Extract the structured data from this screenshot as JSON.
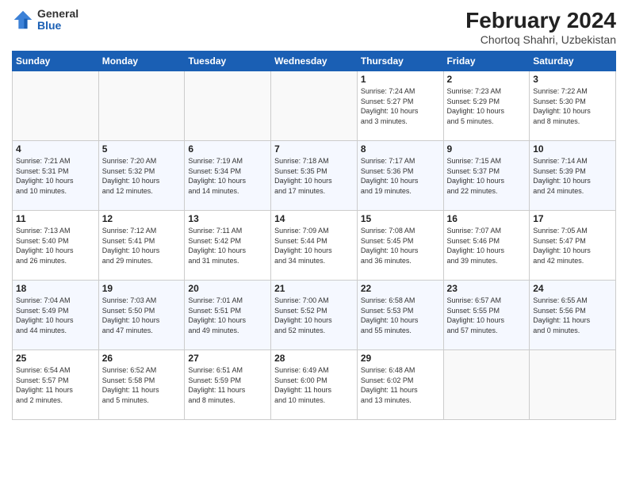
{
  "header": {
    "logo_general": "General",
    "logo_blue": "Blue",
    "month_year": "February 2024",
    "location": "Chortoq Shahri, Uzbekistan"
  },
  "days_of_week": [
    "Sunday",
    "Monday",
    "Tuesday",
    "Wednesday",
    "Thursday",
    "Friday",
    "Saturday"
  ],
  "weeks": [
    [
      {
        "day": "",
        "info": ""
      },
      {
        "day": "",
        "info": ""
      },
      {
        "day": "",
        "info": ""
      },
      {
        "day": "",
        "info": ""
      },
      {
        "day": "1",
        "info": "Sunrise: 7:24 AM\nSunset: 5:27 PM\nDaylight: 10 hours\nand 3 minutes."
      },
      {
        "day": "2",
        "info": "Sunrise: 7:23 AM\nSunset: 5:29 PM\nDaylight: 10 hours\nand 5 minutes."
      },
      {
        "day": "3",
        "info": "Sunrise: 7:22 AM\nSunset: 5:30 PM\nDaylight: 10 hours\nand 8 minutes."
      }
    ],
    [
      {
        "day": "4",
        "info": "Sunrise: 7:21 AM\nSunset: 5:31 PM\nDaylight: 10 hours\nand 10 minutes."
      },
      {
        "day": "5",
        "info": "Sunrise: 7:20 AM\nSunset: 5:32 PM\nDaylight: 10 hours\nand 12 minutes."
      },
      {
        "day": "6",
        "info": "Sunrise: 7:19 AM\nSunset: 5:34 PM\nDaylight: 10 hours\nand 14 minutes."
      },
      {
        "day": "7",
        "info": "Sunrise: 7:18 AM\nSunset: 5:35 PM\nDaylight: 10 hours\nand 17 minutes."
      },
      {
        "day": "8",
        "info": "Sunrise: 7:17 AM\nSunset: 5:36 PM\nDaylight: 10 hours\nand 19 minutes."
      },
      {
        "day": "9",
        "info": "Sunrise: 7:15 AM\nSunset: 5:37 PM\nDaylight: 10 hours\nand 22 minutes."
      },
      {
        "day": "10",
        "info": "Sunrise: 7:14 AM\nSunset: 5:39 PM\nDaylight: 10 hours\nand 24 minutes."
      }
    ],
    [
      {
        "day": "11",
        "info": "Sunrise: 7:13 AM\nSunset: 5:40 PM\nDaylight: 10 hours\nand 26 minutes."
      },
      {
        "day": "12",
        "info": "Sunrise: 7:12 AM\nSunset: 5:41 PM\nDaylight: 10 hours\nand 29 minutes."
      },
      {
        "day": "13",
        "info": "Sunrise: 7:11 AM\nSunset: 5:42 PM\nDaylight: 10 hours\nand 31 minutes."
      },
      {
        "day": "14",
        "info": "Sunrise: 7:09 AM\nSunset: 5:44 PM\nDaylight: 10 hours\nand 34 minutes."
      },
      {
        "day": "15",
        "info": "Sunrise: 7:08 AM\nSunset: 5:45 PM\nDaylight: 10 hours\nand 36 minutes."
      },
      {
        "day": "16",
        "info": "Sunrise: 7:07 AM\nSunset: 5:46 PM\nDaylight: 10 hours\nand 39 minutes."
      },
      {
        "day": "17",
        "info": "Sunrise: 7:05 AM\nSunset: 5:47 PM\nDaylight: 10 hours\nand 42 minutes."
      }
    ],
    [
      {
        "day": "18",
        "info": "Sunrise: 7:04 AM\nSunset: 5:49 PM\nDaylight: 10 hours\nand 44 minutes."
      },
      {
        "day": "19",
        "info": "Sunrise: 7:03 AM\nSunset: 5:50 PM\nDaylight: 10 hours\nand 47 minutes."
      },
      {
        "day": "20",
        "info": "Sunrise: 7:01 AM\nSunset: 5:51 PM\nDaylight: 10 hours\nand 49 minutes."
      },
      {
        "day": "21",
        "info": "Sunrise: 7:00 AM\nSunset: 5:52 PM\nDaylight: 10 hours\nand 52 minutes."
      },
      {
        "day": "22",
        "info": "Sunrise: 6:58 AM\nSunset: 5:53 PM\nDaylight: 10 hours\nand 55 minutes."
      },
      {
        "day": "23",
        "info": "Sunrise: 6:57 AM\nSunset: 5:55 PM\nDaylight: 10 hours\nand 57 minutes."
      },
      {
        "day": "24",
        "info": "Sunrise: 6:55 AM\nSunset: 5:56 PM\nDaylight: 11 hours\nand 0 minutes."
      }
    ],
    [
      {
        "day": "25",
        "info": "Sunrise: 6:54 AM\nSunset: 5:57 PM\nDaylight: 11 hours\nand 2 minutes."
      },
      {
        "day": "26",
        "info": "Sunrise: 6:52 AM\nSunset: 5:58 PM\nDaylight: 11 hours\nand 5 minutes."
      },
      {
        "day": "27",
        "info": "Sunrise: 6:51 AM\nSunset: 5:59 PM\nDaylight: 11 hours\nand 8 minutes."
      },
      {
        "day": "28",
        "info": "Sunrise: 6:49 AM\nSunset: 6:00 PM\nDaylight: 11 hours\nand 10 minutes."
      },
      {
        "day": "29",
        "info": "Sunrise: 6:48 AM\nSunset: 6:02 PM\nDaylight: 11 hours\nand 13 minutes."
      },
      {
        "day": "",
        "info": ""
      },
      {
        "day": "",
        "info": ""
      }
    ]
  ]
}
